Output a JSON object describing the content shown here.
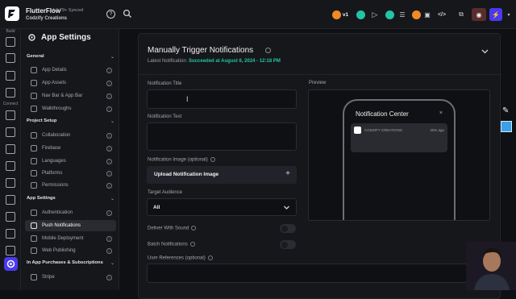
{
  "topbar": {
    "app_name": "FlutterFlow",
    "version": "v4.1.79+",
    "sync_status": "Synced",
    "project_name": "Codzify Creations",
    "version_badge": "v1"
  },
  "rail": {
    "build_label": "Build",
    "connect_label": "Connect"
  },
  "nav": {
    "title": "App Settings",
    "sections": [
      {
        "title": "General",
        "items": [
          "App Details",
          "App Assets",
          "Nav Bar & App Bar",
          "Walkthroughs"
        ]
      },
      {
        "title": "Project Setup",
        "items": [
          "Collaboration",
          "Firebase",
          "Languages",
          "Platforms",
          "Permissions"
        ]
      },
      {
        "title": "App Settings",
        "items": [
          "Authentication",
          "Push Notifications",
          "Mobile Deployment",
          "Web Publishing"
        ]
      },
      {
        "title": "In App Purchases & Subscriptions",
        "items": [
          "Stripe"
        ]
      }
    ],
    "active_item": "Push Notifications"
  },
  "panel": {
    "title": "Manually Trigger Notifications",
    "latest_prefix": "Latest Notification:",
    "latest_status": "Succeeded at August 6, 2024 - 12:18 PM",
    "notification_title_label": "Notification Title",
    "notification_title_value": "",
    "notification_text_label": "Notification Text",
    "notification_text_value": "",
    "notification_image_label": "Notification Image (optional)",
    "upload_button": "Upload Notification Image",
    "target_audience_label": "Target Audience",
    "target_audience_value": "All",
    "deliver_with_sound_label": "Deliver With Sound",
    "batch_notifications_label": "Batch Notifications",
    "user_references_label": "User References (optional)",
    "preview_label": "Preview",
    "preview": {
      "header": "Notification Center",
      "close": "×",
      "app_name": "CODZIFY CREATIONS",
      "time": "20m ago"
    }
  },
  "colors": {
    "accent": "#4b39ef",
    "success": "#22c3a6",
    "background": "#0f1013",
    "panel": "#16171b"
  }
}
